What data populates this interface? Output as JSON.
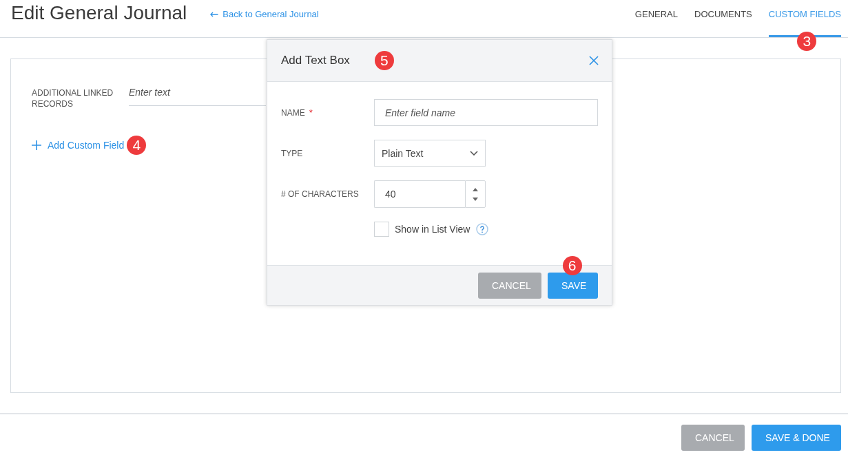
{
  "page": {
    "title": "Edit General Journal",
    "back_link": "Back to General Journal"
  },
  "tabs": [
    {
      "label": "GENERAL",
      "selected": false
    },
    {
      "label": "DOCUMENTS",
      "selected": false
    },
    {
      "label": "CUSTOM FIELDS",
      "selected": true,
      "callout": "3"
    }
  ],
  "form": {
    "fields": [
      {
        "label": "ADDITIONAL LINKED RECORDS",
        "placeholder": "Enter text"
      }
    ],
    "add_field": {
      "label": "Add Custom Field",
      "callout": "4"
    }
  },
  "dialog": {
    "title": "Add Text Box",
    "callout": "5",
    "fields": [
      {
        "kind": "text",
        "label": "NAME",
        "required_mark": "*",
        "placeholder": "Enter field name"
      },
      {
        "kind": "select",
        "label": "TYPE",
        "value": "Plain Text"
      },
      {
        "kind": "number",
        "label": "# OF CHARACTERS",
        "value": "40"
      }
    ],
    "checkbox": {
      "label": "Show in List View",
      "checked": false
    },
    "buttons": [
      {
        "label": "CANCEL",
        "kind": "secondary"
      },
      {
        "label": "SAVE",
        "kind": "primary",
        "callout": "6"
      }
    ]
  },
  "footer": {
    "buttons": [
      {
        "label": "CANCEL",
        "kind": "secondary"
      },
      {
        "label": "SAVE & DONE",
        "kind": "primary"
      }
    ]
  }
}
